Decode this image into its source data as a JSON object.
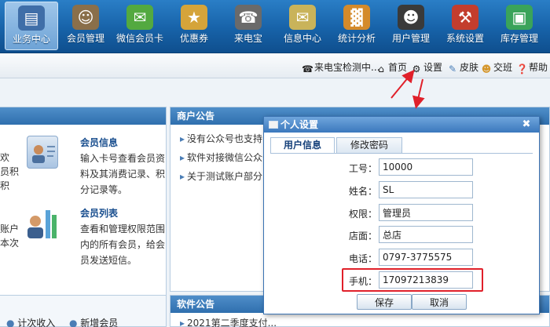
{
  "nav": {
    "items": [
      {
        "label": "业务中心",
        "icon": "business-icon",
        "color": "#3f6ea8"
      },
      {
        "label": "会员管理",
        "icon": "member-icon",
        "color": "#8a6f4a"
      },
      {
        "label": "微信会员卡",
        "icon": "wechat-icon",
        "color": "#53a940"
      },
      {
        "label": "优惠券",
        "icon": "coupon-icon",
        "color": "#d5a43a"
      },
      {
        "label": "来电宝",
        "icon": "phone-icon",
        "color": "#6a6a6a"
      },
      {
        "label": "信息中心",
        "icon": "message-icon",
        "color": "#c9b35a"
      },
      {
        "label": "统计分析",
        "icon": "chart-icon",
        "color": "#d48a2a"
      },
      {
        "label": "用户管理",
        "icon": "user-icon",
        "color": "#3a3a3a"
      },
      {
        "label": "系统设置",
        "icon": "tools-icon",
        "color": "#c33d2d"
      },
      {
        "label": "库存管理",
        "icon": "inventory-icon",
        "color": "#3aa35a"
      }
    ]
  },
  "toolbar": {
    "detect": "来电宝检测中...",
    "home": "首页",
    "settings": "设置",
    "skin": "皮肤",
    "shift": "交班",
    "help": "帮助"
  },
  "left_panel": {
    "cut_lines": [
      "欢",
      "员积",
      "积"
    ],
    "cut_lines2": [
      "账户",
      "本次"
    ],
    "card1_title": "会员信息",
    "card1_desc": "输入卡号查看会员资料及其消费记录、积分记录等。",
    "card2_title": "会员列表",
    "card2_desc": "查看和管理权限范围内的所有会员，给会员发送短信。",
    "bottom_a": "计次收入",
    "bottom_b": "新增会员"
  },
  "merchant_notice": {
    "title": "商户公告",
    "items": [
      "没有公众号也支持",
      "软件对接微信公众号",
      "关于测试账户部分"
    ]
  },
  "software_notice": {
    "title": "软件公告",
    "first_item": "2021第二季度支付..."
  },
  "dialog": {
    "title": "个人设置",
    "tabs": [
      "用户信息",
      "修改密码"
    ],
    "fields": [
      {
        "label": "工号：",
        "value": "10000"
      },
      {
        "label": "姓名：",
        "value": "SL"
      },
      {
        "label": "权限：",
        "value": "管理员"
      },
      {
        "label": "店面：",
        "value": "总店"
      },
      {
        "label": "电话：",
        "value": "0797-3775575"
      },
      {
        "label": "手机：",
        "value": "17097213839"
      }
    ],
    "save": "保存",
    "cancel": "取消"
  },
  "colors": {
    "nav_bg": "#1762a8",
    "panel_head": "#2f6fae",
    "highlight": "#e0202a",
    "arrow": "#e0202a"
  }
}
